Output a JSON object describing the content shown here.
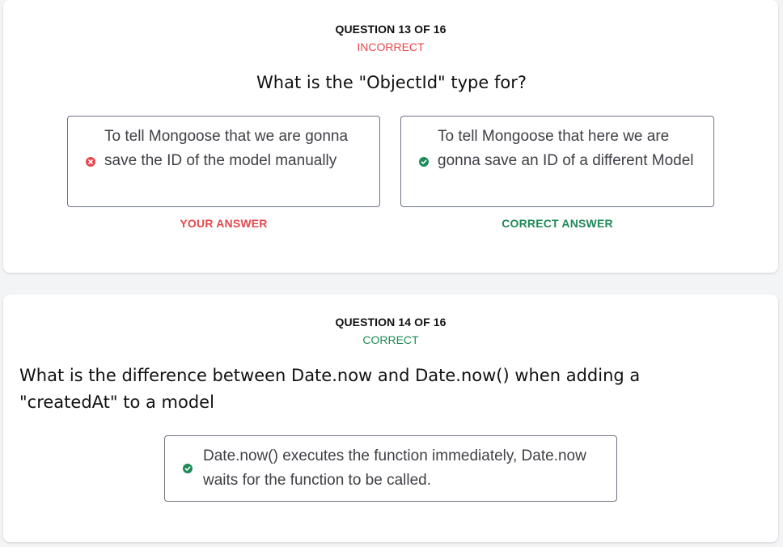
{
  "questions": [
    {
      "counter": "QUESTION 13 OF 16",
      "status": "INCORRECT",
      "text": "What is the \"ObjectId\" type for?",
      "your_answer": {
        "text": "To tell Mongoose that we are gonna save the ID of the model manually",
        "label": "YOUR ANSWER",
        "icon": "x-circle-icon"
      },
      "correct_answer": {
        "text": "To tell Mongoose that here we are gonna save an ID of a different Model",
        "label": "CORRECT ANSWER",
        "icon": "check-circle-icon"
      }
    },
    {
      "counter": "QUESTION 14 OF 16",
      "status": "CORRECT",
      "text": "What is the difference between Date.now and Date.now() when adding a \"createdAt\" to a model",
      "answer": {
        "text": "Date.now() executes the function immediately, Date.now waits for the function to be called.",
        "icon": "check-circle-icon"
      }
    }
  ],
  "colors": {
    "incorrect": "#e5484d",
    "correct": "#1f8a57",
    "background": "#f3f4f6"
  }
}
